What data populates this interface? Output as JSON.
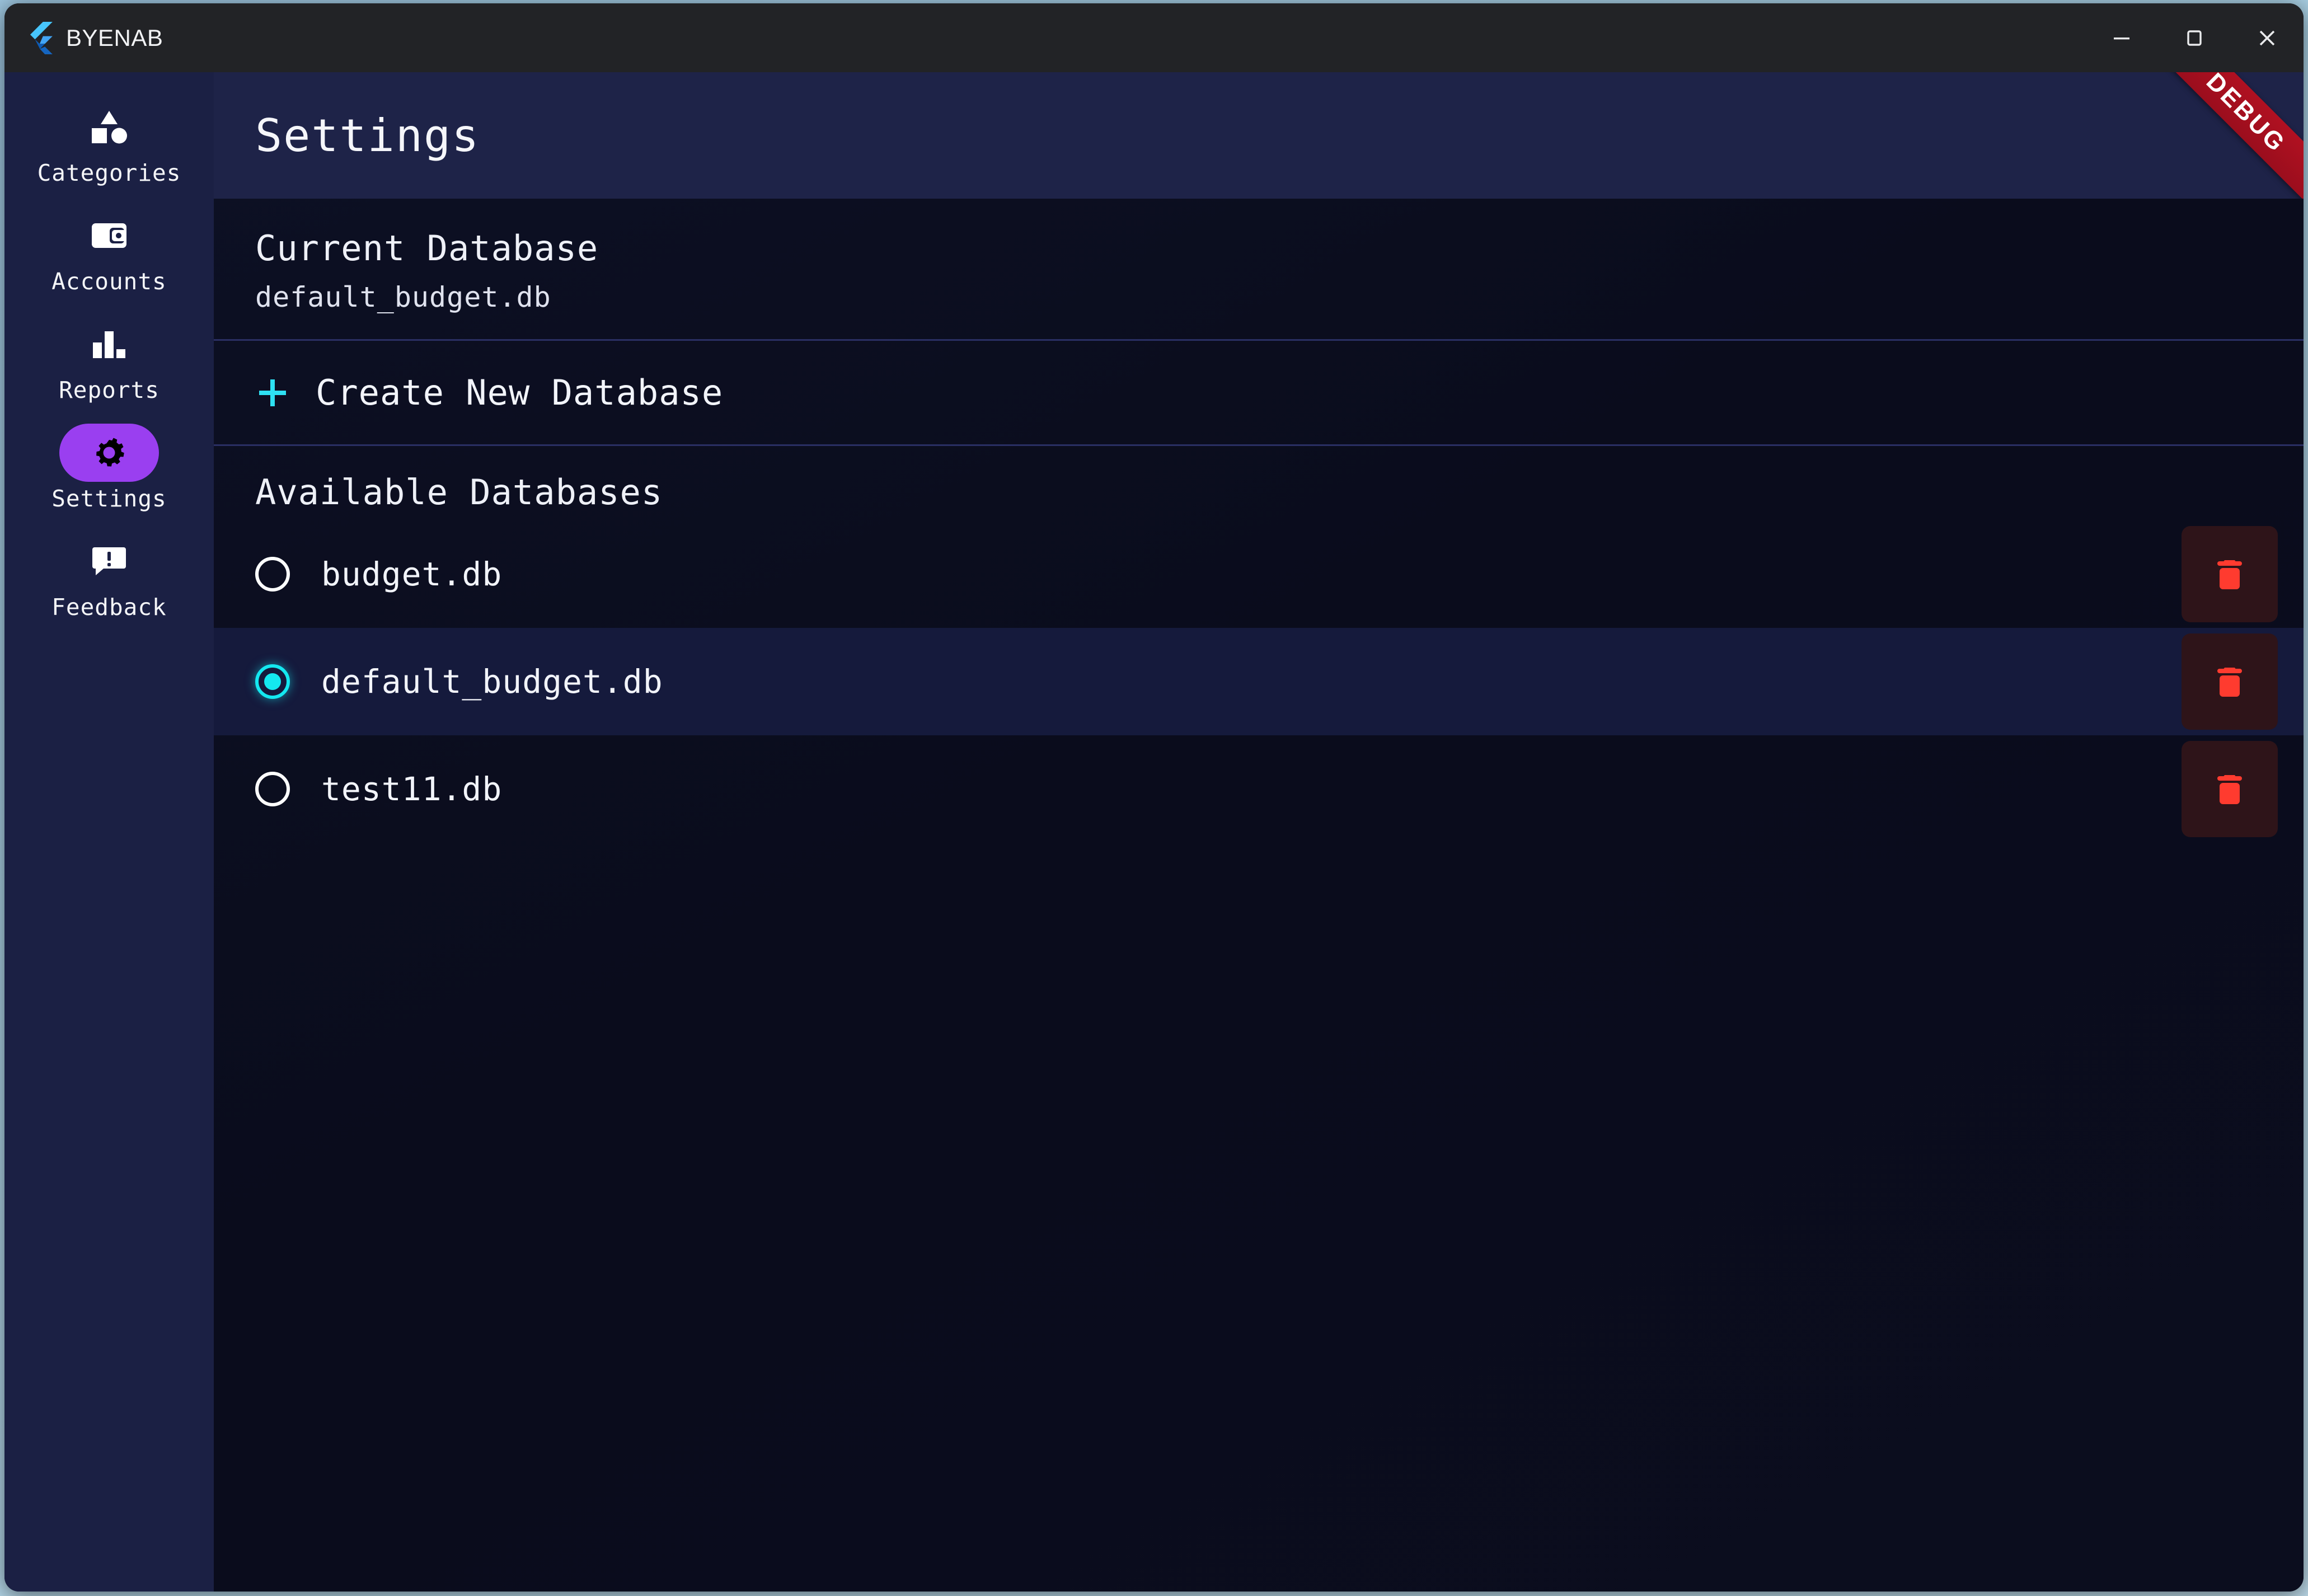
{
  "window": {
    "app_title": "BYENAB",
    "logo_icon": "flutter-logo",
    "controls": [
      {
        "name": "minimize",
        "icon": "minimize-icon"
      },
      {
        "name": "maximize",
        "icon": "maximize-icon"
      },
      {
        "name": "close",
        "icon": "close-icon"
      }
    ]
  },
  "sidebar": {
    "items": [
      {
        "label": "Categories",
        "icon": "category-icon",
        "active": false
      },
      {
        "label": "Accounts",
        "icon": "wallet-icon",
        "active": false
      },
      {
        "label": "Reports",
        "icon": "bar-chart-icon",
        "active": false
      },
      {
        "label": "Settings",
        "icon": "gear-icon",
        "active": true
      },
      {
        "label": "Feedback",
        "icon": "feedback-icon",
        "active": false
      }
    ]
  },
  "header": {
    "title": "Settings",
    "debug_banner": "DEBUG"
  },
  "current_database": {
    "heading": "Current Database",
    "value": "default_budget.db"
  },
  "create_database": {
    "label": "Create New Database",
    "icon": "plus-icon"
  },
  "available_databases": {
    "heading": "Available Databases",
    "delete_icon": "trash-icon",
    "rows": [
      {
        "name": "budget.db",
        "selected": false
      },
      {
        "name": "default_budget.db",
        "selected": true
      },
      {
        "name": "test11.db",
        "selected": false
      }
    ]
  },
  "colors": {
    "accent_purple": "#9a3ff0",
    "accent_cyan": "#14e8f0",
    "danger_red": "#ff3b2f",
    "sidebar_bg": "#1b2044",
    "header_bg": "#1e2348",
    "content_bg": "#0a0c1c",
    "titlebar_bg": "#222326",
    "debug_red": "#b01021"
  }
}
